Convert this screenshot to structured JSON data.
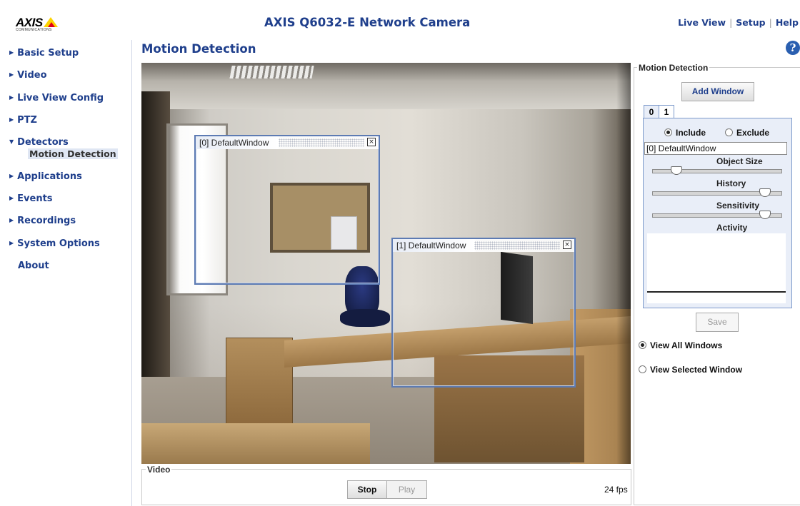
{
  "brand": {
    "logo_text": "AXIS",
    "logo_sub": "COMMUNICATIONS"
  },
  "header": {
    "product_title": "AXIS Q6032-E Network Camera",
    "nav": [
      "Live View",
      "Setup",
      "Help"
    ]
  },
  "sidebar": {
    "items": [
      {
        "label": "Basic Setup",
        "arrow": "▶"
      },
      {
        "label": "Video",
        "arrow": "▶"
      },
      {
        "label": "Live View Config",
        "arrow": "▶"
      },
      {
        "label": "PTZ",
        "arrow": "▶"
      },
      {
        "label": "Detectors",
        "arrow": "▼",
        "expanded": true,
        "sub": "Motion Detection"
      },
      {
        "label": "Applications",
        "arrow": "▶"
      },
      {
        "label": "Events",
        "arrow": "▶"
      },
      {
        "label": "Recordings",
        "arrow": "▶"
      },
      {
        "label": "System Options",
        "arrow": "▶"
      },
      {
        "label": "About",
        "arrow": ""
      }
    ]
  },
  "page": {
    "title": "Motion Detection",
    "help_icon": "?"
  },
  "video": {
    "windows": [
      {
        "title": "[0] DefaultWindow",
        "close": "×"
      },
      {
        "title": "[1] DefaultWindow",
        "close": "×"
      }
    ],
    "controls": {
      "group_label": "Video",
      "stop": "Stop",
      "play": "Play",
      "fps": "24 fps"
    }
  },
  "panel": {
    "group_label": "Motion Detection",
    "add_window": "Add Window",
    "tabs": [
      "0",
      "1"
    ],
    "selected_tab": "0",
    "include": "Include",
    "exclude": "Exclude",
    "include_selected": true,
    "window_name": "[0] DefaultWindow",
    "object_size_label": "Object Size",
    "history_label": "History",
    "sensitivity_label": "Sensitivity",
    "activity_label": "Activity",
    "object_size_value": 0.15,
    "history_value": 0.9,
    "sensitivity_value": 0.9,
    "save": "Save",
    "view_all": "View All Windows",
    "view_selected": "View Selected Window",
    "view_all_selected": true
  },
  "colors": {
    "link": "#1f3f8c",
    "window_border": "#5d7bb3",
    "tab_border": "#7d9acb"
  }
}
